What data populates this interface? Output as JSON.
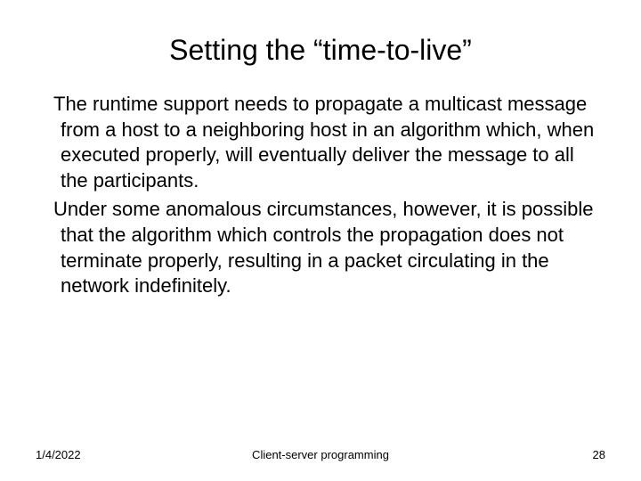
{
  "slide": {
    "title": "Setting the “time-to-live”",
    "paragraph1": "The runtime support needs to propagate a multicast message from a host to a neighboring host in an algorithm which, when executed properly, will eventually deliver the message to all the participants.",
    "paragraph2": "Under some anomalous circumstances, however, it is possible that the algorithm which controls the propagation does not terminate properly, resulting in a packet circulating in the network indefinitely."
  },
  "footer": {
    "date": "1/4/2022",
    "center": "Client-server programming",
    "page": "28"
  }
}
